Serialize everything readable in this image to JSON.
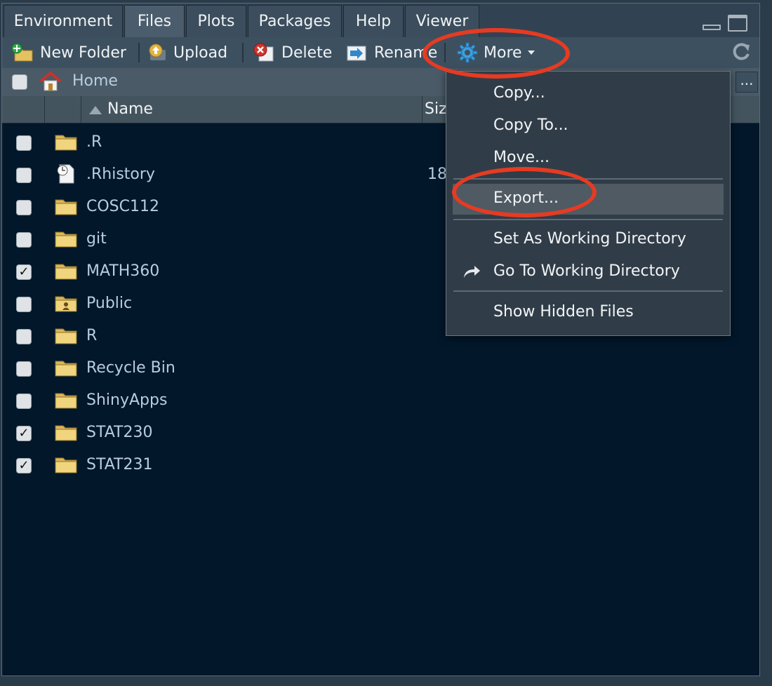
{
  "tabs": [
    {
      "label": "Environment"
    },
    {
      "label": "Files"
    },
    {
      "label": "Plots"
    },
    {
      "label": "Packages"
    },
    {
      "label": "Help"
    },
    {
      "label": "Viewer"
    }
  ],
  "toolbar": {
    "new_folder": "New Folder",
    "upload": "Upload",
    "delete": "Delete",
    "rename": "Rename",
    "more": "More"
  },
  "path": {
    "home": "Home",
    "more": "..."
  },
  "columns": {
    "name": "Name",
    "size": "Siz"
  },
  "files": [
    {
      "name": ".R",
      "type": "folder",
      "checked": false,
      "size": ""
    },
    {
      "name": ".Rhistory",
      "type": "history-file",
      "checked": false,
      "size": "18"
    },
    {
      "name": "COSC112",
      "type": "folder",
      "checked": false,
      "size": ""
    },
    {
      "name": "git",
      "type": "folder",
      "checked": false,
      "size": ""
    },
    {
      "name": "MATH360",
      "type": "folder",
      "checked": true,
      "size": ""
    },
    {
      "name": "Public",
      "type": "public-folder",
      "checked": false,
      "size": ""
    },
    {
      "name": "R",
      "type": "folder",
      "checked": false,
      "size": ""
    },
    {
      "name": "Recycle Bin",
      "type": "folder",
      "checked": false,
      "size": ""
    },
    {
      "name": "ShinyApps",
      "type": "folder",
      "checked": false,
      "size": ""
    },
    {
      "name": "STAT230",
      "type": "folder",
      "checked": true,
      "size": ""
    },
    {
      "name": "STAT231",
      "type": "folder",
      "checked": true,
      "size": ""
    }
  ],
  "menu": {
    "items": [
      {
        "label": "Copy..."
      },
      {
        "label": "Copy To..."
      },
      {
        "label": "Move..."
      },
      {
        "label": "Export..."
      },
      {
        "label": "Set As Working Directory"
      },
      {
        "label": "Go To Working Directory"
      },
      {
        "label": "Show Hidden Files"
      }
    ],
    "highlighted": "Export..."
  },
  "colors": {
    "annotation": "#e63b22",
    "pane_bg": "#02172a",
    "link_text": "#b9cde0"
  }
}
